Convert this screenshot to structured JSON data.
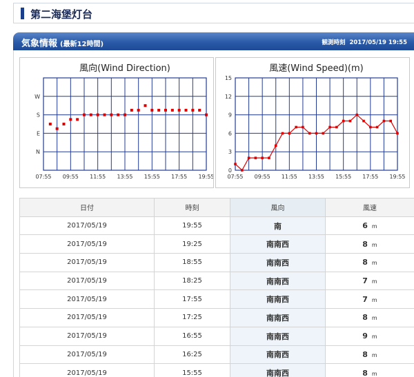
{
  "page": {
    "title": "第二海堡灯台"
  },
  "section": {
    "title": "気象情報",
    "subtitle": "(最新12時間)",
    "observed_label": "観測時刻",
    "observed_time": "2017/05/19 19:55"
  },
  "chart_data": [
    {
      "type": "scatter",
      "title": "風向(Wind Direction)",
      "x_ticks": [
        "07:55",
        "09:55",
        "11:55",
        "13:55",
        "15:55",
        "17:55",
        "19:55"
      ],
      "y_ticks": [
        "W",
        "S",
        "E",
        "N"
      ],
      "y_tick_values": [
        270,
        180,
        90,
        0
      ],
      "ylim": [
        -90,
        360
      ],
      "xlim": [
        "07:55",
        "19:55"
      ],
      "grid": true,
      "x": [
        "08:25",
        "08:55",
        "09:25",
        "09:55",
        "10:25",
        "10:55",
        "11:25",
        "11:55",
        "12:25",
        "12:55",
        "13:25",
        "13:55",
        "14:25",
        "14:55",
        "15:25",
        "15:55",
        "16:25",
        "16:55",
        "17:25",
        "17:55",
        "18:25",
        "18:55",
        "19:25",
        "19:55"
      ],
      "values": [
        135,
        112.5,
        135,
        157.5,
        157.5,
        180,
        180,
        180,
        180,
        180,
        180,
        180,
        202.5,
        202.5,
        225,
        202.5,
        202.5,
        202.5,
        202.5,
        202.5,
        202.5,
        202.5,
        202.5,
        180
      ],
      "color": "#e00000"
    },
    {
      "type": "line",
      "title": "風速(Wind Speed)(m)",
      "x_ticks": [
        "07:55",
        "09:55",
        "11:55",
        "13:55",
        "15:55",
        "17:55",
        "19:55"
      ],
      "y_ticks": [
        15,
        12,
        9,
        6,
        3,
        0
      ],
      "ylim": [
        0,
        15
      ],
      "xlim": [
        "07:55",
        "19:55"
      ],
      "grid": true,
      "x": [
        "07:55",
        "08:25",
        "08:55",
        "09:25",
        "09:55",
        "10:25",
        "10:55",
        "11:25",
        "11:55",
        "12:25",
        "12:55",
        "13:25",
        "13:55",
        "14:25",
        "14:55",
        "15:25",
        "15:55",
        "16:25",
        "16:55",
        "17:25",
        "17:55",
        "18:25",
        "18:55",
        "19:25",
        "19:55"
      ],
      "values": [
        1,
        0,
        2,
        2,
        2,
        2,
        4,
        6,
        6,
        7,
        7,
        6,
        6,
        6,
        7,
        7,
        8,
        8,
        9,
        8,
        7,
        7,
        8,
        8,
        6
      ],
      "color": "#e00000"
    }
  ],
  "table": {
    "headers": [
      "日付",
      "時刻",
      "風向",
      "風速"
    ],
    "unit": "m",
    "rows": [
      {
        "date": "2017/05/19",
        "time": "19:55",
        "direction": "南",
        "speed": "6"
      },
      {
        "date": "2017/05/19",
        "time": "19:25",
        "direction": "南南西",
        "speed": "8"
      },
      {
        "date": "2017/05/19",
        "time": "18:55",
        "direction": "南南西",
        "speed": "8"
      },
      {
        "date": "2017/05/19",
        "time": "18:25",
        "direction": "南南西",
        "speed": "7"
      },
      {
        "date": "2017/05/19",
        "time": "17:55",
        "direction": "南南西",
        "speed": "7"
      },
      {
        "date": "2017/05/19",
        "time": "17:25",
        "direction": "南南西",
        "speed": "8"
      },
      {
        "date": "2017/05/19",
        "time": "16:55",
        "direction": "南南西",
        "speed": "9"
      },
      {
        "date": "2017/05/19",
        "time": "16:25",
        "direction": "南南西",
        "speed": "8"
      },
      {
        "date": "2017/05/19",
        "time": "15:55",
        "direction": "南南西",
        "speed": "8"
      }
    ]
  }
}
